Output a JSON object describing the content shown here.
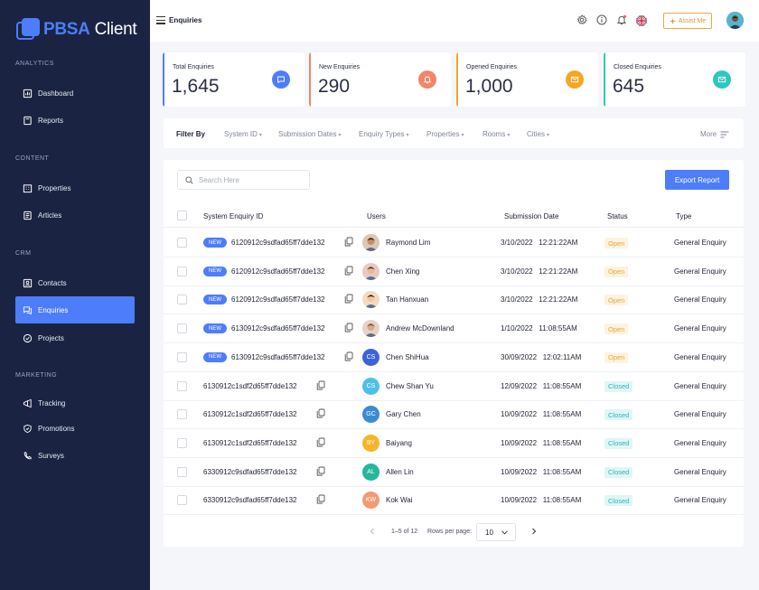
{
  "app": {
    "logo_prefix": "PBSA",
    "logo_suffix": " Client"
  },
  "sidebar": {
    "sections": [
      "ANALYTICS",
      "CONTENT",
      "CRM",
      "MARKETING"
    ],
    "items": [
      {
        "label": "Dashboard",
        "icon": "dashboard-icon"
      },
      {
        "label": "Reports",
        "icon": "reports-icon"
      },
      {
        "label": "Properties",
        "icon": "properties-icon"
      },
      {
        "label": "Articles",
        "icon": "articles-icon"
      },
      {
        "label": "Contacts",
        "icon": "contacts-icon"
      },
      {
        "label": "Enquiries",
        "icon": "enquiries-icon",
        "active": true
      },
      {
        "label": "Projects",
        "icon": "projects-icon"
      },
      {
        "label": "Tracking",
        "icon": "tracking-icon"
      },
      {
        "label": "Promotions",
        "icon": "promotions-icon"
      },
      {
        "label": "Surveys",
        "icon": "surveys-icon"
      }
    ]
  },
  "header": {
    "title": "Enquiries",
    "assist_label": "Assist Me"
  },
  "stats": [
    {
      "label": "Total Enquiries",
      "value": "1,645",
      "color": "#4d7dfa",
      "icon": "chat-icon"
    },
    {
      "label": "New Enquiries",
      "value": "290",
      "color": "#f0866a",
      "icon": "bell-icon"
    },
    {
      "label": "Opened Enquiries",
      "value": "1,000",
      "color": "#f5a623",
      "icon": "mail-icon"
    },
    {
      "label": "Closed Enquiries",
      "value": "645",
      "color": "#2ec7c0",
      "icon": "mail-check-icon"
    }
  ],
  "filters": {
    "label": "Filter By",
    "items": [
      "System ID",
      "Submission Dates",
      "Enquiry Types",
      "Properties",
      "Rooms",
      "Cities"
    ],
    "more": "More"
  },
  "table": {
    "search_placeholder": "Search Here",
    "export_label": "Export Report",
    "headers": [
      "System Enquiry ID",
      "Users",
      "Submission Date",
      "Status",
      "Type"
    ],
    "new_label": "NEW",
    "rows": [
      {
        "is_new": true,
        "id": "6120912c9sdfad65ff7dde132",
        "user": "Raymond Lim",
        "initials": "",
        "avatar_color": "#d9c7b8",
        "date": "3/10/2022   12:21:22AM",
        "status": "Open",
        "type": "General Enquiry"
      },
      {
        "is_new": true,
        "id": "6120912c9sdfad65ff7dde132",
        "user": "Chen Xing",
        "initials": "",
        "avatar_color": "#e8c9c2",
        "date": "3/10/2022   12:21:22AM",
        "status": "Open",
        "type": "General Enquiry"
      },
      {
        "is_new": true,
        "id": "6120912c9sdfad65ff7dde132",
        "user": "Tan Hanxuan",
        "initials": "",
        "avatar_color": "#f1dcc2",
        "date": "3/10/2022   12:21:22AM",
        "status": "Open",
        "type": "General Enquiry"
      },
      {
        "is_new": true,
        "id": "6130912c9sdfad65ff7dde132",
        "user": "Andrew McDownland",
        "initials": "",
        "avatar_color": "#e6d2c7",
        "date": "1/10/2022   11:08:55AM",
        "status": "Open",
        "type": "General Enquiry"
      },
      {
        "is_new": true,
        "id": "6130912c9sdfad65ff7dde132",
        "user": "Chen ShiHua",
        "initials": "CS",
        "avatar_color": "#3d63d8",
        "date": "30/09/2022   12:02:11AM",
        "status": "Open",
        "type": "General Enquiry"
      },
      {
        "is_new": false,
        "id": "6130912c1sdf2d65ff7dde132",
        "user": "Chew Shan Yu",
        "initials": "CS",
        "avatar_color": "#4cc1e8",
        "date": "12/09/2022   11:08:55AM",
        "status": "Closed",
        "type": "General Enquiry"
      },
      {
        "is_new": false,
        "id": "6130912c1sdf2d65ff7dde132",
        "user": "Gary Chen",
        "initials": "GC",
        "avatar_color": "#3a8ccf",
        "date": "10/09/2022   11:08:55AM",
        "status": "Closed",
        "type": "General Enquiry"
      },
      {
        "is_new": false,
        "id": "6130912c1sdf2d65ff7dde132",
        "user": "Baiyang",
        "initials": "BY",
        "avatar_color": "#f5b526",
        "date": "10/09/2022   11:08:55AM",
        "status": "Closed",
        "type": "General Enquiry"
      },
      {
        "is_new": false,
        "id": "6330912c9sdfad65ff7dde132",
        "user": "Allen Lin",
        "initials": "AL",
        "avatar_color": "#23b89a",
        "date": "10/09/2022   11:08:55AM",
        "status": "Closed",
        "type": "General Enquiry"
      },
      {
        "is_new": false,
        "id": "6330912c9sdfad65ff7dde132",
        "user": "Kok Wai",
        "initials": "KW",
        "avatar_color": "#f29a72",
        "date": "10/09/2022   11:08:55AM",
        "status": "Closed",
        "type": "General Enquiry"
      }
    ]
  },
  "pagination": {
    "range": "1–5 of 12",
    "rows_per_page_label": "Rows per page:",
    "rows_per_page": "10"
  }
}
